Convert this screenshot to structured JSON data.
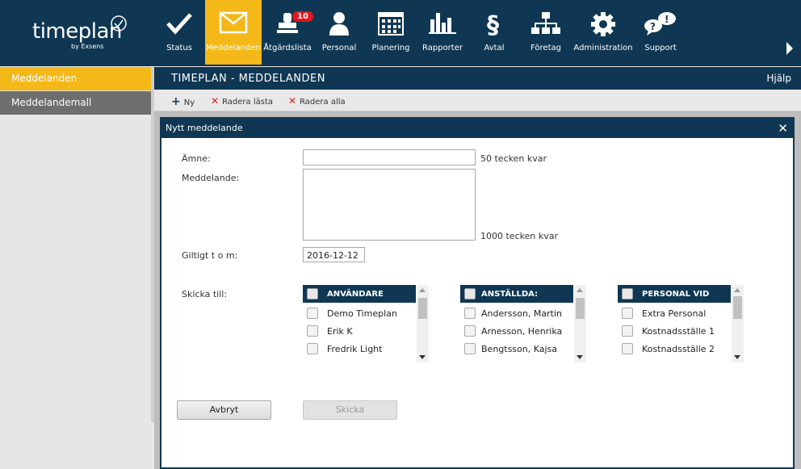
{
  "app": {
    "logo_text": "timeplan",
    "logo_by": "by Exsens"
  },
  "nav": {
    "items": [
      {
        "label": "Status",
        "icon": "checkmark-icon"
      },
      {
        "label": "Meddelanden",
        "icon": "envelope-icon",
        "active": true
      },
      {
        "label": "Åtgärdslista",
        "icon": "stamp-icon",
        "badge": "10"
      },
      {
        "label": "Personal",
        "icon": "person-icon"
      },
      {
        "label": "Planering",
        "icon": "calendar-icon"
      },
      {
        "label": "Rapporter",
        "icon": "bar-chart-icon"
      },
      {
        "label": "Avtal",
        "icon": "paragraph-icon"
      },
      {
        "label": "Företag",
        "icon": "org-chart-icon"
      },
      {
        "label": "Administration",
        "icon": "gear-icon"
      },
      {
        "label": "Support",
        "icon": "chat-help-icon"
      }
    ]
  },
  "sidebar": {
    "items": [
      {
        "label": "Meddelanden",
        "active": true
      },
      {
        "label": "Meddelandemall",
        "active": false
      }
    ]
  },
  "main": {
    "title": "TIMEPLAN - MEDDELANDEN",
    "help": "Hjälp"
  },
  "toolbar": {
    "new_label": "Ny",
    "delete_read_label": "Radera lästa",
    "delete_all_label": "Radera alla"
  },
  "dialog": {
    "title": "Nytt meddelande",
    "close": "✕",
    "subject_label": "Ämne:",
    "subject_value": "",
    "subject_hint": "50 tecken kvar",
    "message_label": "Meddelande:",
    "message_value": "",
    "message_hint": "1000 tecken kvar",
    "valid_label": "Giltigt t o m:",
    "valid_value": "2016-12-12",
    "send_to_label": "Skicka till:",
    "lists": [
      {
        "header": "ANVÄNDARE",
        "rows": [
          "Demo Timeplan",
          "Erik K",
          "Fredrik Light"
        ]
      },
      {
        "header": "ANSTÄLLDA:",
        "rows": [
          "Andersson, Martin",
          "Arnesson, Henrika",
          "Bengtsson, Kajsa"
        ]
      },
      {
        "header": "PERSONAL VID",
        "rows": [
          "Extra Personal",
          "Kostnadsställe 1",
          "Kostnadsställe 2"
        ]
      }
    ],
    "cancel_label": "Avbryt",
    "send_label": "Skicka"
  },
  "colors": {
    "navy": "#0f3753",
    "accent": "#f4b819",
    "badge": "#e4161e"
  }
}
